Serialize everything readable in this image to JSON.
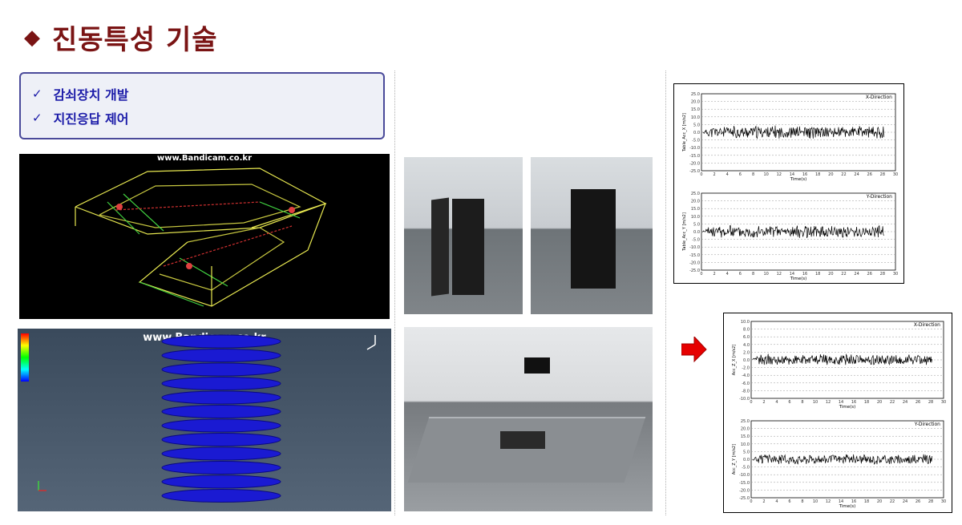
{
  "title": "진동특성 기술",
  "title_marker": "◆",
  "features": [
    {
      "check": "✓",
      "label": "감쇠장치 개발"
    },
    {
      "check": "✓",
      "label": "지진응답 제어"
    }
  ],
  "watermarks": {
    "wireframe": "www.Bandicam.co.kr",
    "fea": "www.Bandicam.co.kr"
  },
  "colors": {
    "title": "#7a1414",
    "feature_text": "#1a1aa8",
    "arrow": "#e60000",
    "spring": "#1a1ad2"
  },
  "chart_data": [
    {
      "type": "line",
      "title": "X-Direction",
      "xlabel": "Time(s)",
      "ylabel": "Table_Acc_X [m/s2]",
      "xlim": [
        0,
        30
      ],
      "ylim": [
        -25,
        25
      ],
      "xticks": [
        0,
        2,
        4,
        6,
        8,
        10,
        12,
        14,
        16,
        18,
        20,
        22,
        24,
        26,
        28,
        30
      ],
      "yticks": [
        "25.0",
        "20.0",
        "15.0",
        "10.0",
        "5.0",
        "0.0",
        "-5.0",
        "-10.0",
        "-15.0",
        "-20.0",
        "-25.0"
      ],
      "signal": {
        "description": "random vibration",
        "amplitude": 4.5,
        "duration": 28
      }
    },
    {
      "type": "line",
      "title": "Y-Direction",
      "xlabel": "Time(s)",
      "ylabel": "Table_Acc_Y [m/s2]",
      "xlim": [
        0,
        30
      ],
      "ylim": [
        -25,
        25
      ],
      "xticks": [
        0,
        2,
        4,
        6,
        8,
        10,
        12,
        14,
        16,
        18,
        20,
        22,
        24,
        26,
        28,
        30
      ],
      "yticks": [
        "25.0",
        "20.0",
        "15.0",
        "10.0",
        "5.0",
        "0.0",
        "-5.0",
        "-10.0",
        "-15.0",
        "-20.0",
        "-25.0"
      ],
      "signal": {
        "description": "random vibration",
        "amplitude": 4.5,
        "duration": 28
      }
    },
    {
      "type": "line",
      "title": "X-Direction",
      "xlabel": "Time(s)",
      "ylabel": "Acc_Z_X [m/s2]",
      "xlim": [
        0,
        30
      ],
      "ylim": [
        -10,
        10
      ],
      "xticks": [
        0,
        2,
        4,
        6,
        8,
        10,
        12,
        14,
        16,
        18,
        20,
        22,
        24,
        26,
        28,
        30
      ],
      "yticks": [
        "10.0",
        "8.0",
        "6.0",
        "4.0",
        "2.0",
        "0.0",
        "-2.0",
        "-4.0",
        "-6.0",
        "-8.0",
        "-10.0"
      ],
      "signal": {
        "description": "random vibration",
        "amplitude": 1.6,
        "duration": 28
      }
    },
    {
      "type": "line",
      "title": "Y-Direction",
      "xlabel": "Time(s)",
      "ylabel": "Acc_Z_Y [m/s2]",
      "xlim": [
        0,
        30
      ],
      "ylim": [
        -25,
        25
      ],
      "xticks": [
        0,
        2,
        4,
        6,
        8,
        10,
        12,
        14,
        16,
        18,
        20,
        22,
        24,
        26,
        28,
        30
      ],
      "yticks": [
        "25.0",
        "20.0",
        "15.0",
        "10.0",
        "5.0",
        "0.0",
        "-5.0",
        "-10.0",
        "-15.0",
        "-20.0",
        "-25.0"
      ],
      "signal": {
        "description": "random vibration",
        "amplitude": 3.5,
        "duration": 28
      }
    }
  ]
}
